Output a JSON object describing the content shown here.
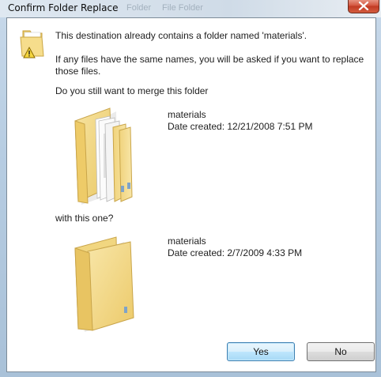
{
  "window": {
    "title": "Confirm Folder Replace",
    "close_icon": "close-icon"
  },
  "background_peek": [
    "Folder",
    "File Folder"
  ],
  "dialog": {
    "message_1": "This destination already contains a folder named 'materials'.",
    "message_2": "If any files have the same names, you will be asked if you want to replace those files.",
    "message_3": "Do you still want to merge this folder",
    "message_4": "with this one?",
    "source_folder": {
      "name": "materials",
      "date_created": "Date created: 12/21/2008 7:51 PM"
    },
    "target_folder": {
      "name": "materials",
      "date_created": "Date created: 2/7/2009 4:33 PM"
    }
  },
  "buttons": {
    "yes": "Yes",
    "no": "No"
  },
  "colors": {
    "folder_yellow": "#f3d985",
    "glass_frame": "#b7cde2",
    "close_red": "#c13a24",
    "default_button_blue": "#3c7fb1"
  }
}
